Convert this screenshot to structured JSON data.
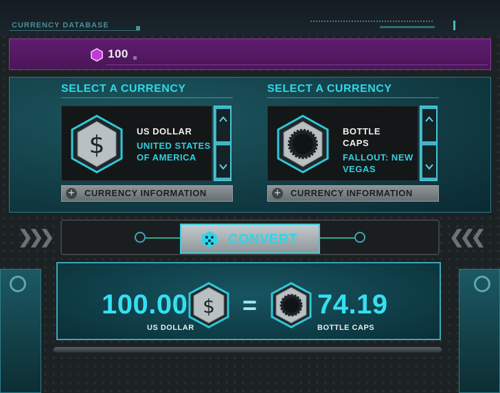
{
  "header": {
    "title": "CURRENCY DATABASE"
  },
  "balance": {
    "value": "100",
    "icon": "purple-hexagon-icon",
    "color": "#5e1d6e"
  },
  "left_select": {
    "heading": "SELECT A CURRENCY",
    "currency_name": [
      "US DOLLAR"
    ],
    "currency_origin": [
      "UNITED STATES",
      "OF AMERICA"
    ],
    "icon": "dollar-sign-icon",
    "info_label": "CURRENCY INFORMATION"
  },
  "right_select": {
    "heading": "SELECT A CURRENCY",
    "currency_name": [
      "BOTTLE",
      "CAPS"
    ],
    "currency_origin": [
      "FALLOUT: NEW",
      "VEGAS"
    ],
    "icon": "bottle-cap-icon",
    "info_label": "CURRENCY INFORMATION"
  },
  "convert": {
    "label": "CONVERT",
    "icon": "dice-icon"
  },
  "result": {
    "from_amount": "100.00",
    "from_unit": "US DOLLAR",
    "equals": "=",
    "to_amount": "74.19",
    "to_unit": "BOTTLE CAPS"
  },
  "colors": {
    "accent": "#30d7ea",
    "panel": "#0f3a42",
    "purple": "#5e1d6e"
  }
}
